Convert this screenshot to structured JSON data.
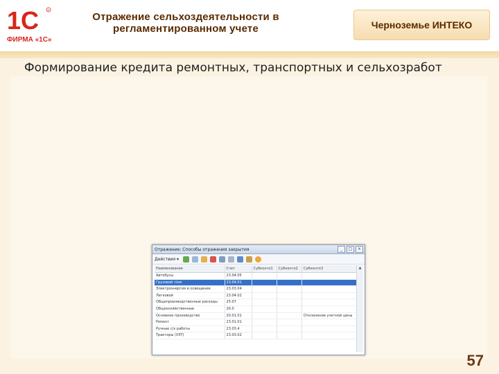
{
  "header": {
    "logo_text": "1С",
    "logo_sub": "ФИРМА «1С»",
    "title_line1": "Отражение сельхоздеятельности в",
    "title_line2": "регламентированном учете",
    "badge": "Черноземье ИНТЕКО"
  },
  "slide": {
    "heading": "Формирование кредита ремонтных, транспортных и сельхозработ",
    "page_number": "57"
  },
  "window": {
    "title": "Отражение: Способы отражения закрытия",
    "toolbar": {
      "actions_label": "Действия ▾"
    },
    "columns": [
      "Наименование",
      "Счет",
      "Субконто1",
      "Субконто2",
      "Субконто3"
    ],
    "rows": [
      {
        "name": "Автобусы",
        "account": "23.04.05",
        "s1": "",
        "s2": "",
        "s3": ""
      },
      {
        "name": "Грузовой т/км",
        "account": "23.04.01",
        "s1": "",
        "s2": "",
        "s3": ""
      },
      {
        "name": "Электроэнергия и освещение",
        "account": "23.03.04",
        "s1": "",
        "s2": "",
        "s3": ""
      },
      {
        "name": "Легковой",
        "account": "23.04.02",
        "s1": "",
        "s2": "",
        "s3": ""
      },
      {
        "name": "Общепроизводственные расходы",
        "account": "25.07",
        "s1": "",
        "s2": "",
        "s3": ""
      },
      {
        "name": "Общехозяйственные",
        "account": "26.0",
        "s1": "",
        "s2": "",
        "s3": ""
      },
      {
        "name": "Основное производство",
        "account": "20.01.01",
        "s1": "",
        "s2": "",
        "s3": "Отклонение учетной цены"
      },
      {
        "name": "Ремонт",
        "account": "23.01.01",
        "s1": "",
        "s2": "",
        "s3": ""
      },
      {
        "name": "Ручные с/х работы",
        "account": "23.03.4",
        "s1": "",
        "s2": "",
        "s3": ""
      },
      {
        "name": "Тракторы (УЭТ)",
        "account": "23.03.02",
        "s1": "",
        "s2": "",
        "s3": ""
      }
    ],
    "selected_row": 1
  },
  "colors": {
    "title_color": "#5a2a00",
    "selection": "#3470c8",
    "logo_red": "#d8261c"
  }
}
